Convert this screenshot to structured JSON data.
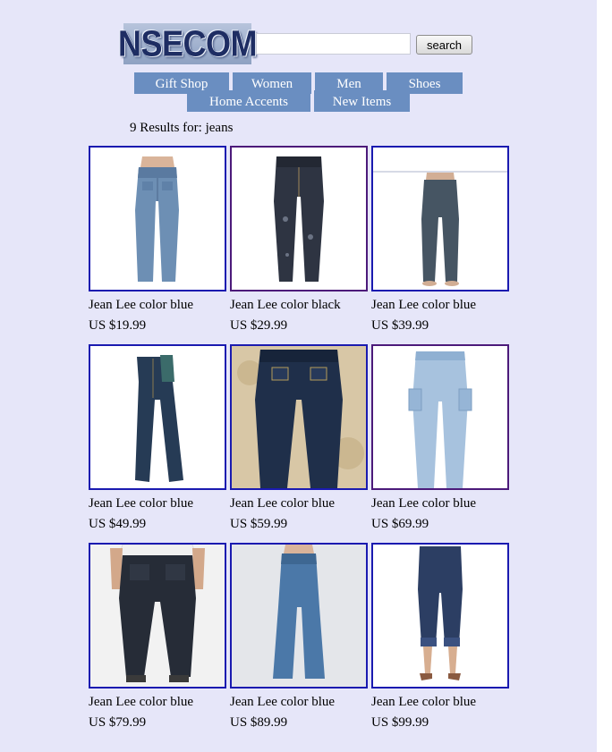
{
  "header": {
    "logo_text": "NSECOM",
    "search": {
      "value": "",
      "placeholder": ""
    },
    "search_button_label": "search"
  },
  "nav": {
    "tabs": [
      {
        "label": "Gift Shop"
      },
      {
        "label": "Women"
      },
      {
        "label": "Men"
      },
      {
        "label": "Shoes"
      },
      {
        "label": "Home Accents"
      },
      {
        "label": "New Items"
      }
    ]
  },
  "results": {
    "summary": "9 Results for: jeans",
    "products": [
      {
        "name": "Jean Lee color blue",
        "price": "US $19.99",
        "image": "light-blue-jeans-on-model-back-view"
      },
      {
        "name": "Jean Lee color black",
        "price": "US $29.99",
        "image": "dark-distressed-jeans"
      },
      {
        "name": "Jean Lee color blue",
        "price": "US $39.99",
        "image": "dark-grey-jeans-on-model"
      },
      {
        "name": "Jean Lee color blue",
        "price": "US $49.99",
        "image": "dark-blue-jeans-folded"
      },
      {
        "name": "Jean Lee color blue",
        "price": "US $59.99",
        "image": "dark-jeans-on-tan-background"
      },
      {
        "name": "Jean Lee color blue",
        "price": "US $69.99",
        "image": "light-cargo-jeans"
      },
      {
        "name": "Jean Lee color blue",
        "price": "US $79.99",
        "image": "black-jeans-on-model-rear-view"
      },
      {
        "name": "Jean Lee color blue",
        "price": "US $89.99",
        "image": "medium-blue-flare-jeans-on-model"
      },
      {
        "name": "Jean Lee color blue",
        "price": "US $99.99",
        "image": "cropped-dark-jeans-with-heels"
      }
    ]
  },
  "colors": {
    "page_background": "#e6e6f9",
    "nav_tab": "#6a8ec1",
    "link_border": "#1a1ab0",
    "visited_border": "#4c1a7a",
    "logo_text": "#1e2d63"
  }
}
